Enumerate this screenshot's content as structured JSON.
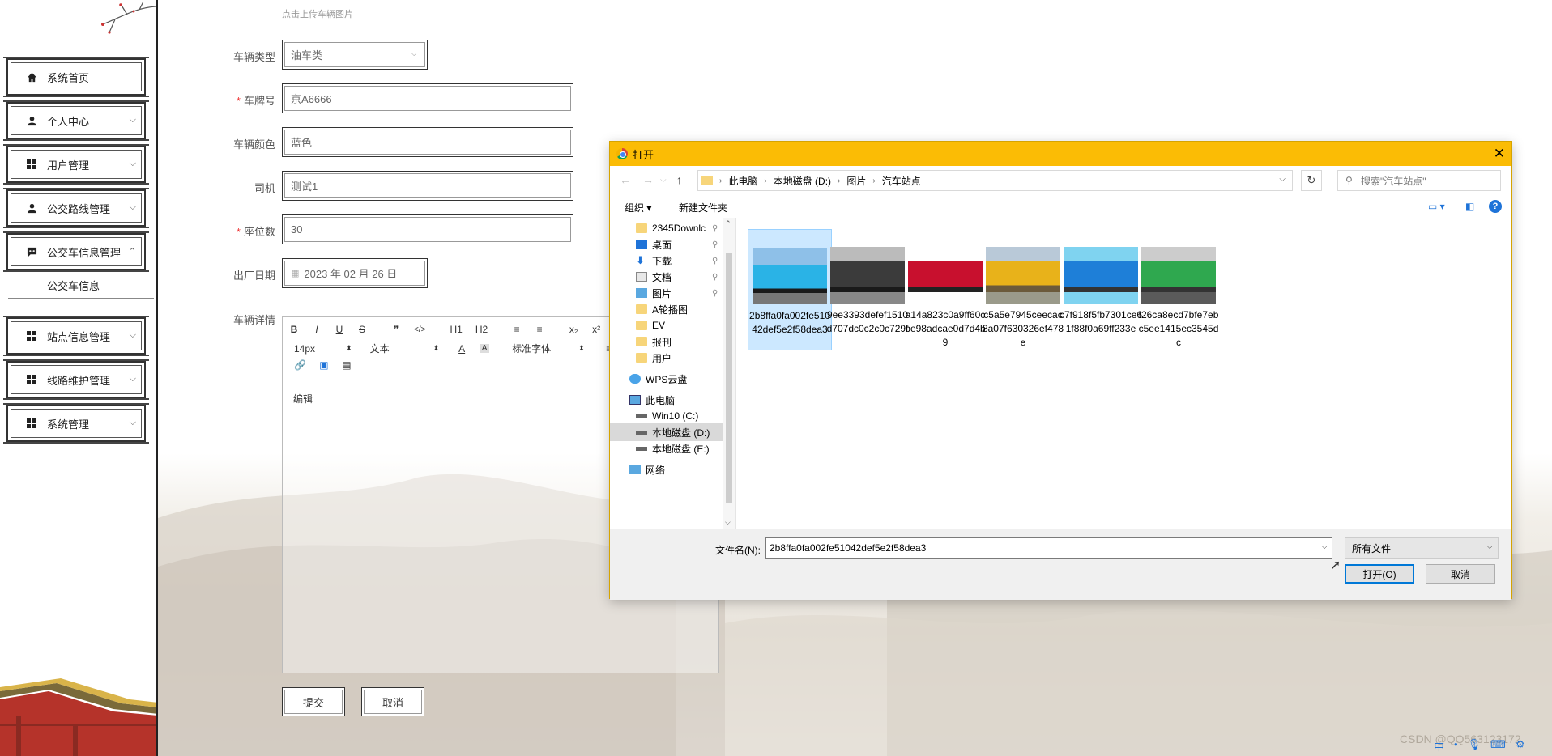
{
  "sidebar": {
    "menu": [
      {
        "label": "系统首页",
        "icon": "home-icon"
      },
      {
        "label": "个人中心",
        "icon": "user-icon"
      },
      {
        "label": "用户管理",
        "icon": "grid-icon"
      },
      {
        "label": "公交路线管理",
        "icon": "user-icon"
      },
      {
        "label": "公交车信息管理",
        "icon": "chat-icon"
      },
      {
        "label": "站点信息管理",
        "icon": "grid-icon"
      },
      {
        "label": "线路维护管理",
        "icon": "grid-icon"
      },
      {
        "label": "系统管理",
        "icon": "grid-icon"
      }
    ],
    "submenu": "公交车信息"
  },
  "form": {
    "upload_hint": "点击上传车辆图片",
    "vehicle_type": {
      "label": "车辆类型",
      "value": "油车类"
    },
    "plate": {
      "label": "车牌号",
      "value": "京A6666",
      "required": true
    },
    "color": {
      "label": "车辆颜色",
      "value": "蓝色"
    },
    "driver": {
      "label": "司机",
      "value": "测试1"
    },
    "seats": {
      "label": "座位数",
      "value": "30",
      "required": true
    },
    "date": {
      "label": "出厂日期",
      "value": "2023 年 02 月 26 日"
    },
    "details": {
      "label": "车辆详情",
      "content": "编辑"
    },
    "submit": "提交",
    "cancel": "取消",
    "required_mark": "*"
  },
  "editor": {
    "toolbar_row1": [
      "B",
      "I",
      "U",
      "S",
      "❞",
      "</>",
      "H1",
      "H2",
      "≡",
      "≡",
      "x₂",
      "x²",
      "⇤"
    ],
    "font_size": "14px",
    "text_type": "文本",
    "font_family": "标准字体"
  },
  "dialog": {
    "title": "打开",
    "breadcrumb": [
      "此电脑",
      "本地磁盘 (D:)",
      "图片",
      "汽车站点"
    ],
    "search_placeholder": "搜索\"汽车站点\"",
    "organize": "组织 ▾",
    "new_folder": "新建文件夹",
    "tree": [
      {
        "label": "2345Downlc",
        "icon": "folder-icon",
        "pinned": true
      },
      {
        "label": "桌面",
        "icon": "desktop-icon",
        "pinned": true
      },
      {
        "label": "下载",
        "icon": "download-icon",
        "pinned": true
      },
      {
        "label": "文档",
        "icon": "document-icon",
        "pinned": true
      },
      {
        "label": "图片",
        "icon": "picture-icon",
        "pinned": true
      },
      {
        "label": "A轮播图",
        "icon": "folder-icon"
      },
      {
        "label": "EV",
        "icon": "folder-icon"
      },
      {
        "label": "报刊",
        "icon": "folder-icon"
      },
      {
        "label": "用户",
        "icon": "folder-icon"
      },
      {
        "label": "WPS云盘",
        "icon": "cloud-icon"
      },
      {
        "label": "此电脑",
        "icon": "computer-icon"
      },
      {
        "label": "Win10 (C:)",
        "icon": "drive-icon"
      },
      {
        "label": "本地磁盘 (D:)",
        "icon": "drive-icon",
        "selected": true
      },
      {
        "label": "本地磁盘 (E:)",
        "icon": "drive-icon"
      },
      {
        "label": "网络",
        "icon": "network-icon"
      }
    ],
    "files": [
      {
        "name": "2b8ffa0fa002fe51042def5e2f58dea3",
        "selected": true,
        "colors": [
          "#2ab3e6",
          "#1a1a1a"
        ]
      },
      {
        "name": "9ee3393defef1510d707dc0c2c0c729f",
        "colors": [
          "#3b3b3b",
          "#888888"
        ]
      },
      {
        "name": "a14a823c0a9ff60cbe98adcae0d7d4b9",
        "colors": [
          "#c8102e",
          "#222222"
        ]
      },
      {
        "name": "c5a5e7945ceecac8a07f630326ef478e",
        "colors": [
          "#e8b21a",
          "#6b5a3a"
        ]
      },
      {
        "name": "c7f918f5fb7301ce61f88f0a69ff233e",
        "colors": [
          "#1e7fd8",
          "#7fd3f0"
        ]
      },
      {
        "name": "f26ca8ecd7bfe7ebc5ee1415ec3545dc",
        "colors": [
          "#2fa84f",
          "#5a5a5a"
        ]
      }
    ],
    "filename_label": "文件名(N):",
    "filename_value": "2b8ffa0fa002fe51042def5e2f58dea3",
    "filetype": "所有文件",
    "open": "打开(O)",
    "cancel": "取消"
  },
  "watermark": "CSDN @QQ563123172"
}
